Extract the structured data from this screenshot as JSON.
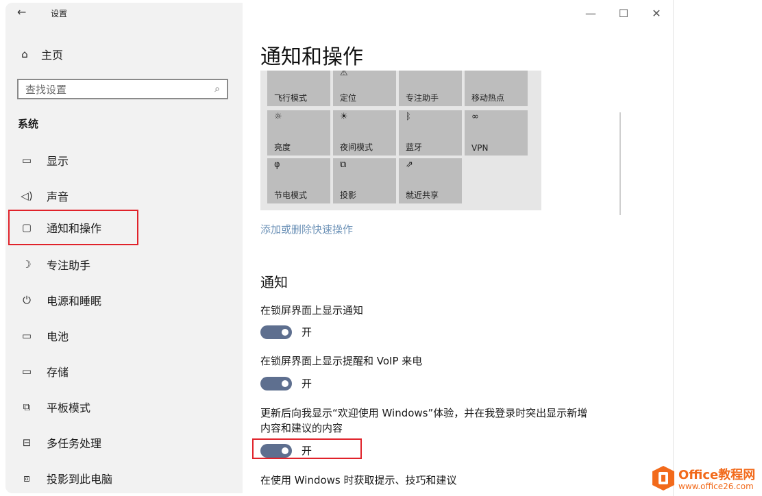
{
  "window": {
    "app_title": "设置",
    "controls": {
      "minimize": "—",
      "maximize": "☐",
      "close": "✕"
    }
  },
  "sidebar": {
    "home_label": "主页",
    "search_placeholder": "查找设置",
    "section_title": "系统",
    "items": [
      {
        "label": "显示",
        "icon": "monitor-icon"
      },
      {
        "label": "声音",
        "icon": "speaker-icon"
      },
      {
        "label": "通知和操作",
        "icon": "notification-icon",
        "selected": true
      },
      {
        "label": "专注助手",
        "icon": "moon-icon"
      },
      {
        "label": "电源和睡眠",
        "icon": "power-icon"
      },
      {
        "label": "电池",
        "icon": "battery-icon"
      },
      {
        "label": "存储",
        "icon": "storage-icon"
      },
      {
        "label": "平板模式",
        "icon": "tablet-icon"
      },
      {
        "label": "多任务处理",
        "icon": "multitask-icon"
      },
      {
        "label": "投影到此电脑",
        "icon": "project-icon"
      }
    ]
  },
  "main": {
    "title": "通知和操作",
    "quick_actions": [
      {
        "label": "飞行模式",
        "icon": "airplane-icon"
      },
      {
        "label": "定位",
        "icon": "location-icon"
      },
      {
        "label": "专注助手",
        "icon": "moon-icon"
      },
      {
        "label": "移动热点",
        "icon": "hotspot-icon"
      },
      {
        "label": "亮度",
        "icon": "brightness-icon"
      },
      {
        "label": "夜间模式",
        "icon": "night-light-icon"
      },
      {
        "label": "蓝牙",
        "icon": "bluetooth-icon"
      },
      {
        "label": "VPN",
        "icon": "vpn-icon"
      },
      {
        "label": "节电模式",
        "icon": "battery-saver-icon"
      },
      {
        "label": "投影",
        "icon": "project-icon"
      },
      {
        "label": "就近共享",
        "icon": "nearby-share-icon"
      }
    ],
    "edit_link": "添加或删除快速操作",
    "notifications_title": "通知",
    "settings": [
      {
        "label": "在锁屏界面上显示通知",
        "state": "开"
      },
      {
        "label": "在锁屏界面上显示提醒和 VoIP 来电",
        "state": "开"
      },
      {
        "label": "更新后向我显示“欢迎使用 Windows”体验，并在我登录时突出显示新增内容和建议的内容",
        "state": "开"
      },
      {
        "label": "在使用 Windows 时获取提示、技巧和建议"
      }
    ]
  },
  "watermark": {
    "line1": "Office教程网",
    "line2": "www.office26.com"
  },
  "colors": {
    "toggle_on": "#5e6f8f",
    "highlight": "#e0222a",
    "link": "#6e93b8",
    "tile": "#bdbdbd"
  }
}
